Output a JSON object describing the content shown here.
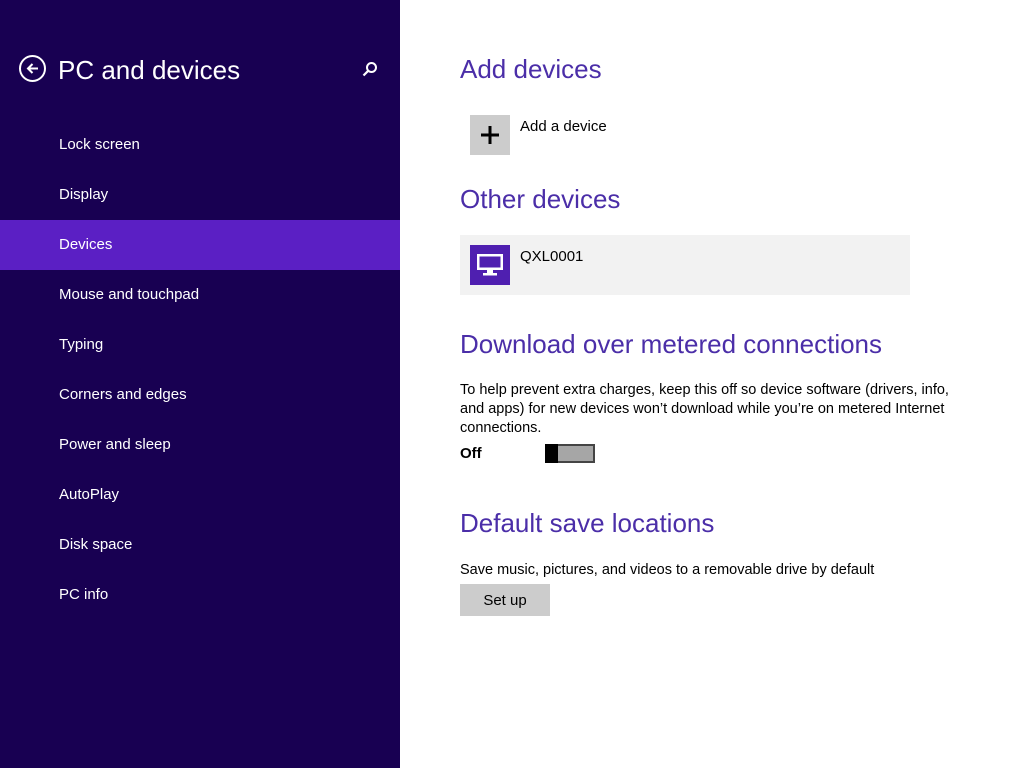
{
  "sidebar": {
    "title": "PC and devices",
    "back_icon": "back-arrow-icon",
    "search_icon": "search-icon",
    "selected_index": 2,
    "items": [
      {
        "label": "Lock screen"
      },
      {
        "label": "Display"
      },
      {
        "label": "Devices"
      },
      {
        "label": "Mouse and touchpad"
      },
      {
        "label": "Typing"
      },
      {
        "label": "Corners and edges"
      },
      {
        "label": "Power and sleep"
      },
      {
        "label": "AutoPlay"
      },
      {
        "label": "Disk space"
      },
      {
        "label": "PC info"
      }
    ]
  },
  "main": {
    "add_devices": {
      "title": "Add devices",
      "add_label": "Add a device",
      "icon": "plus-icon"
    },
    "other_devices": {
      "title": "Other devices",
      "devices": [
        {
          "name": "QXL0001",
          "icon": "monitor-icon"
        }
      ]
    },
    "metered": {
      "title": "Download over metered connections",
      "description": "To help prevent extra charges, keep this off so device software (drivers, info, and apps) for new devices won’t download while you’re on metered Internet connections.",
      "toggle_state": "Off",
      "toggle_on": false
    },
    "save_locations": {
      "title": "Default save locations",
      "description": "Save music, pictures, and videos to a removable drive by default",
      "button_label": "Set up"
    }
  },
  "colors": {
    "sidebar_bg": "#180052",
    "selected_bg": "#5b1fc4",
    "heading": "#4b2ea8",
    "device_tile": "#4f1fb0"
  }
}
